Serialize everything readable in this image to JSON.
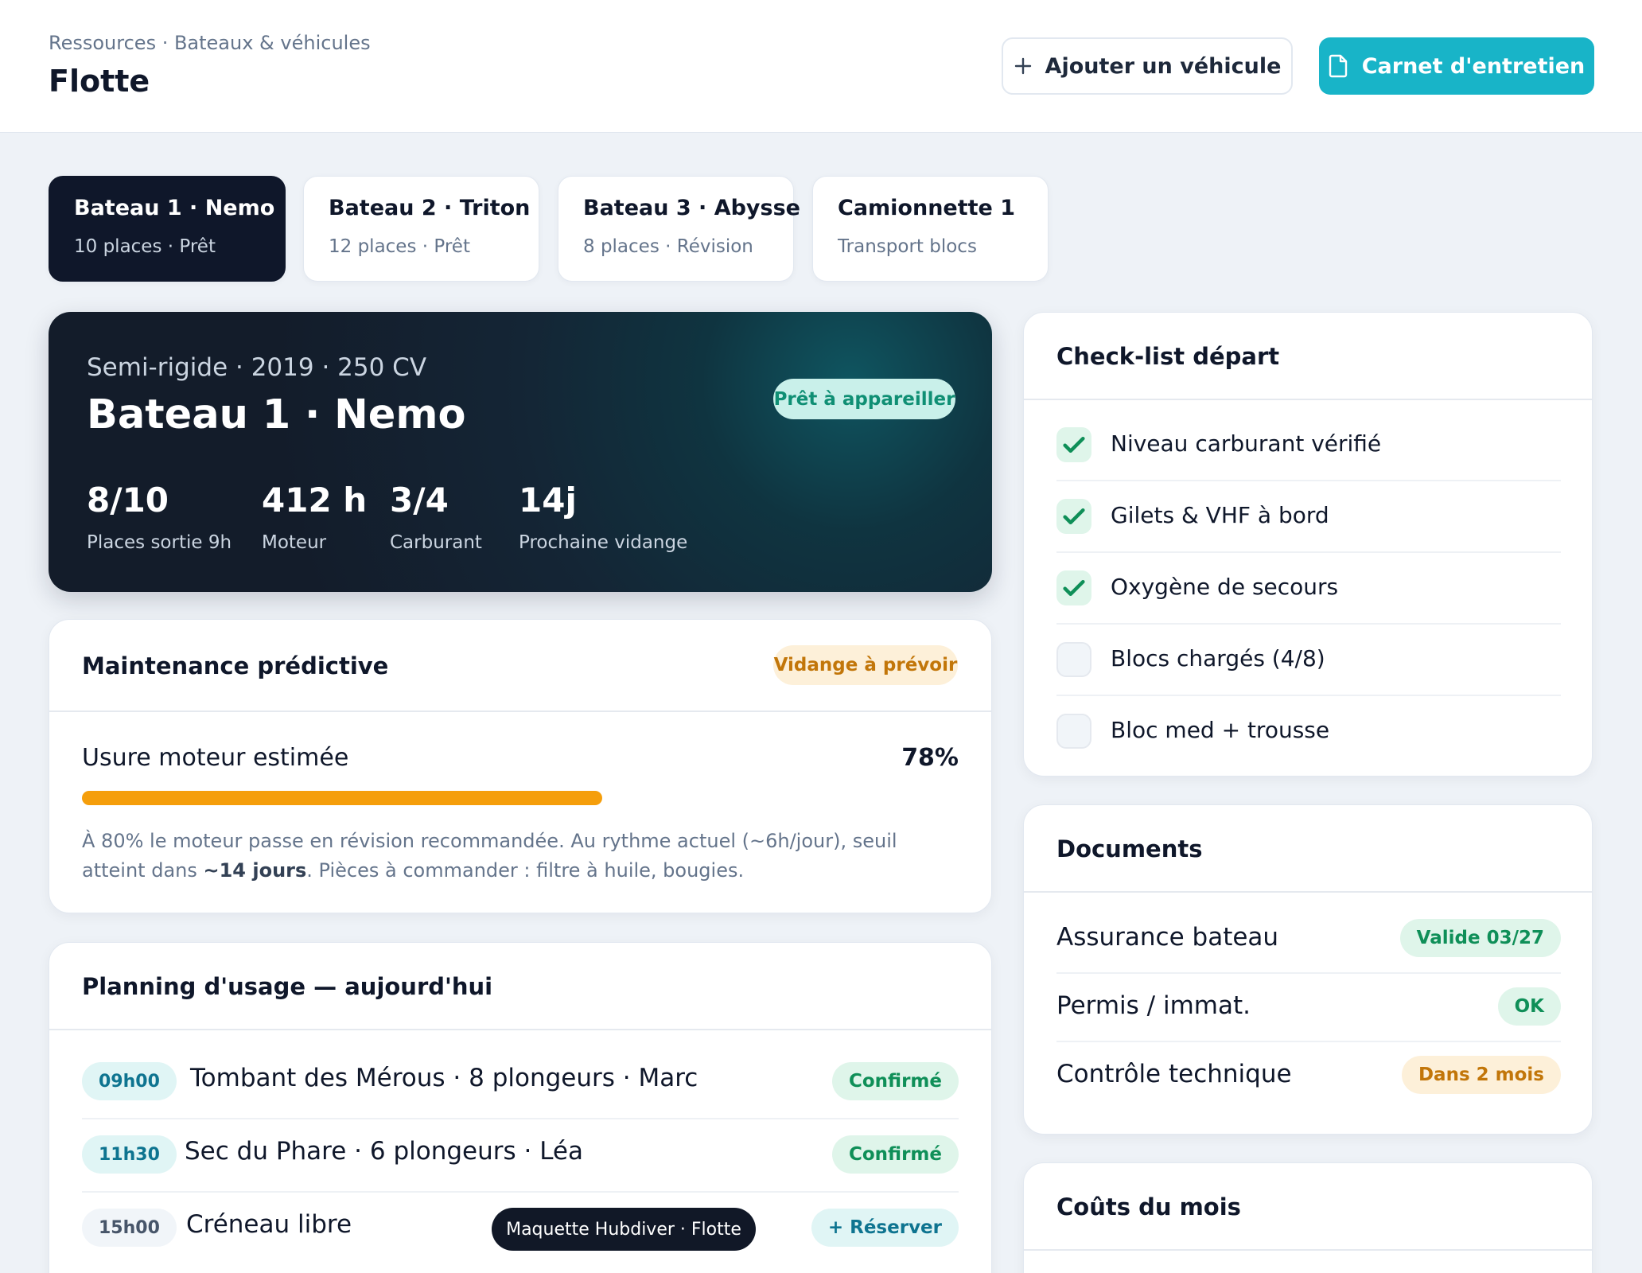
{
  "header": {
    "breadcrumb": "Ressources · Bateaux & véhicules",
    "title": "Flotte",
    "add_vehicle_label": "Ajouter un véhicule",
    "logbook_label": "Carnet d'entretien"
  },
  "vehicle_tabs": [
    {
      "title": "Bateau 1 · Nemo",
      "subtitle": "10 places · Prêt"
    },
    {
      "title": "Bateau 2 · Triton",
      "subtitle": "12 places · Prêt"
    },
    {
      "title": "Bateau 3 · Abysse",
      "subtitle": "8 places · Révision"
    },
    {
      "title": "Camionnette 1",
      "subtitle": "Transport blocs"
    }
  ],
  "hero": {
    "subtitle": "Semi-rigide · 2019 · 250 CV",
    "title": "Bateau 1 · Nemo",
    "status_badge": "Prêt à appareiller",
    "stats": [
      {
        "value": "8/10",
        "label": "Places sortie 9h"
      },
      {
        "value": "412 h",
        "label": "Moteur"
      },
      {
        "value": "3/4",
        "label": "Carburant"
      },
      {
        "value": "14j",
        "label": "Prochaine vidange"
      }
    ]
  },
  "maintenance": {
    "title": "Maintenance prédictive",
    "badge": "Vidange à prévoir",
    "wear_label": "Usure moteur estimée",
    "wear_value": "78%",
    "wear_fraction": 0.78,
    "note_before": "À 80% le moteur passe en révision recommandée. Au rythme actuel (~6h/jour), seuil atteint dans ",
    "note_bold": "~14 jours",
    "note_after": ". Pièces à commander : filtre à huile, bougies."
  },
  "planning": {
    "title": "Planning d'usage — aujourd'hui",
    "rows": [
      {
        "time": "09h00",
        "label": "Tombant des Mérous · 8 plongeurs · Marc",
        "status": "Confirmé"
      },
      {
        "time": "11h30",
        "label": "Sec du Phare · 6 plongeurs · Léa",
        "status": "Confirmé"
      },
      {
        "time": "15h00",
        "label": "Créneau libre",
        "status": "+ Réserver"
      }
    ]
  },
  "toast": "Maquette Hubdiver · Flotte",
  "checklist": {
    "title": "Check-list départ",
    "items": [
      {
        "label": "Niveau carburant vérifié",
        "checked": true
      },
      {
        "label": "Gilets & VHF à bord",
        "checked": true
      },
      {
        "label": "Oxygène de secours",
        "checked": true
      },
      {
        "label": "Blocs chargés (4/8)",
        "checked": false
      },
      {
        "label": "Bloc med + trousse",
        "checked": false
      }
    ]
  },
  "documents": {
    "title": "Documents",
    "items": [
      {
        "label": "Assurance bateau",
        "badge": "Valide 03/27"
      },
      {
        "label": "Permis / immat.",
        "badge": "OK"
      },
      {
        "label": "Contrôle technique",
        "badge": "Dans 2 mois"
      }
    ]
  },
  "costs": {
    "title": "Coûts du mois"
  },
  "colors": {
    "accent": "#18b4c8",
    "warning": "#f59e0b",
    "success": "#0f8f58",
    "dark": "#0f172a"
  }
}
